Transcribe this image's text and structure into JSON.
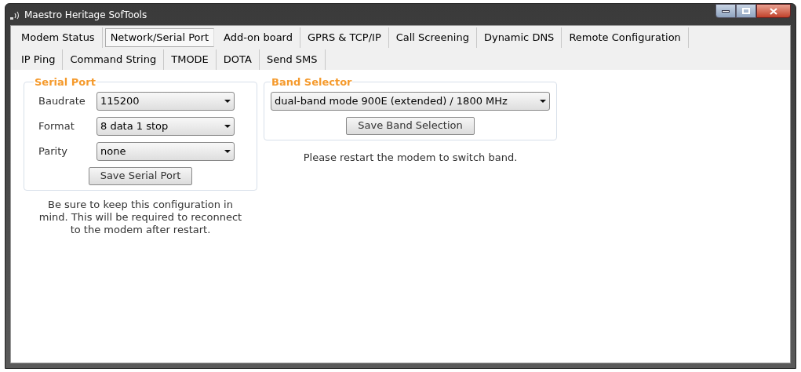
{
  "window": {
    "title": "Maestro Heritage SofTools"
  },
  "tab_rows": [
    [
      {
        "label": "Modem Status",
        "selected": false
      },
      {
        "label": "Network/Serial Port",
        "selected": true
      },
      {
        "label": "Add-on board",
        "selected": false
      },
      {
        "label": "GPRS & TCP/IP",
        "selected": false
      },
      {
        "label": "Call Screening",
        "selected": false
      },
      {
        "label": "Dynamic DNS",
        "selected": false
      },
      {
        "label": "Remote Configuration",
        "selected": false
      }
    ],
    [
      {
        "label": "IP Ping",
        "selected": false
      },
      {
        "label": "Command String",
        "selected": false
      },
      {
        "label": "TMODE",
        "selected": false
      },
      {
        "label": "DOTA",
        "selected": false
      },
      {
        "label": "Send SMS",
        "selected": false
      }
    ]
  ],
  "serial_port": {
    "title": "Serial Port",
    "fields": [
      {
        "label": "Baudrate",
        "value": "115200"
      },
      {
        "label": "Format",
        "value": "8 data 1 stop"
      },
      {
        "label": "Parity",
        "value": "none"
      }
    ],
    "button": "Save Serial Port",
    "note": "Be sure to keep this configuration in mind. This will be required to reconnect to the modem after restart."
  },
  "band_selector": {
    "title": "Band Selector",
    "value": "dual-band mode 900E (extended) / 1800 MHz",
    "button": "Save Band Selection",
    "note": "Please restart the modem to switch band."
  }
}
